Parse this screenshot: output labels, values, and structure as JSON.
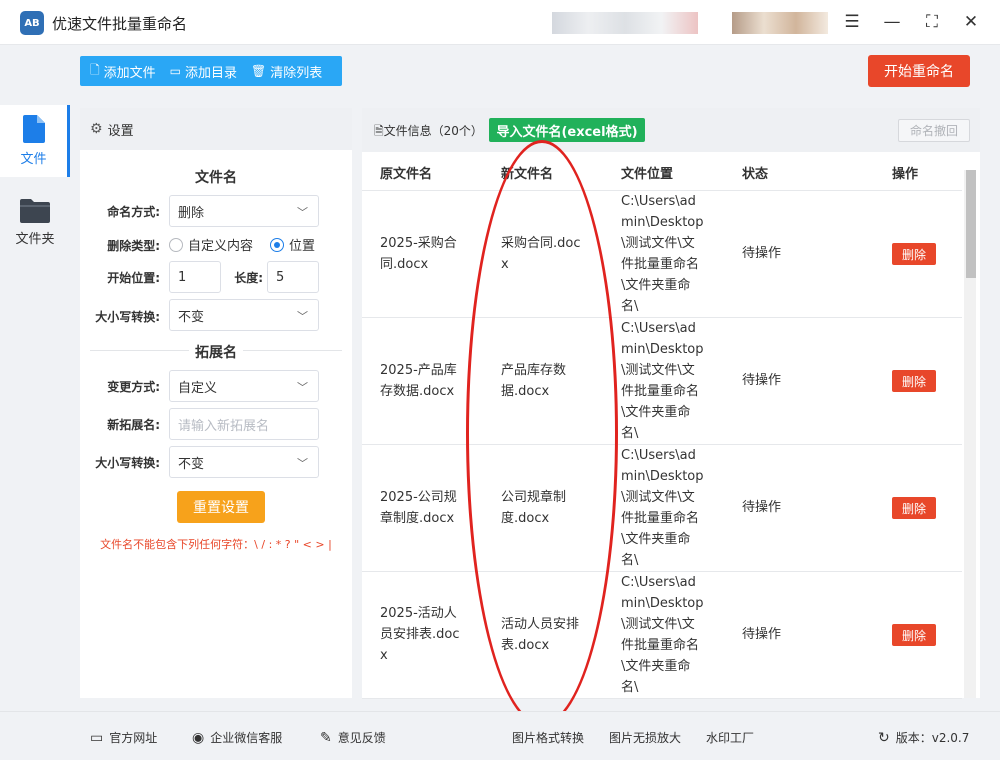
{
  "app": {
    "title": "优速文件批量重命名",
    "logo_text": "AB"
  },
  "window_buttons": {
    "menu": "☰",
    "minimize": "—",
    "maximize": "⛶",
    "close": "✕"
  },
  "nav": {
    "files_label": "文件",
    "folders_label": "文件夹"
  },
  "toolbar": {
    "add_file": "添加文件",
    "add_dir": "添加目录",
    "clear_list": "清除列表",
    "start": "开始重命名"
  },
  "settings": {
    "header": "设置",
    "filename_section": "文件名",
    "naming_label": "命名方式:",
    "naming_value": "删除",
    "delete_type_label": "删除类型:",
    "delete_type_option1": "自定义内容",
    "delete_type_option2": "位置",
    "start_pos_label": "开始位置:",
    "start_pos_value": "1",
    "length_label": "长度:",
    "length_value": "5",
    "case_label": "大小写转换:",
    "case_value": "不变",
    "ext_section": "拓展名",
    "change_mode_label": "变更方式:",
    "change_mode_value": "自定义",
    "new_ext_label": "新拓展名:",
    "new_ext_placeholder": "请输入新拓展名",
    "ext_case_label": "大小写转换:",
    "ext_case_value": "不变",
    "reset": "重置设置",
    "warning": "文件名不能包含下列任何字符：\\ / : * ? \" < > |"
  },
  "files": {
    "title": "文件信息（20个）",
    "import_button": "导入文件名(excel格式)",
    "undo_button": "命名撤回",
    "columns": [
      "原文件名",
      "新文件名",
      "文件位置",
      "状态",
      "操作"
    ],
    "rows": [
      {
        "orig": [
          "2025-采购合",
          "同.docx"
        ],
        "new": [
          "采购合同.doc",
          "x"
        ],
        "loc": [
          "C:\\Users\\ad",
          "min\\Desktop",
          "\\测试文件\\文",
          "件批量重命名",
          "\\文件夹重命",
          "名\\"
        ],
        "status": "待操作",
        "action": "删除"
      },
      {
        "orig": [
          "2025-产品库",
          "存数据.docx"
        ],
        "new": [
          "产品库存数",
          "据.docx"
        ],
        "loc": [
          "C:\\Users\\ad",
          "min\\Desktop",
          "\\测试文件\\文",
          "件批量重命名",
          "\\文件夹重命",
          "名\\"
        ],
        "status": "待操作",
        "action": "删除"
      },
      {
        "orig": [
          "2025-公司规",
          "章制度.docx"
        ],
        "new": [
          "公司规章制",
          "度.docx"
        ],
        "loc": [
          "C:\\Users\\ad",
          "min\\Desktop",
          "\\测试文件\\文",
          "件批量重命名",
          "\\文件夹重命",
          "名\\"
        ],
        "status": "待操作",
        "action": "删除"
      },
      {
        "orig": [
          "2025-活动人",
          "员安排表.doc",
          "x"
        ],
        "new": [
          "活动人员安排",
          "表.docx"
        ],
        "loc": [
          "C:\\Users\\ad",
          "min\\Desktop",
          "\\测试文件\\文",
          "件批量重命名",
          "\\文件夹重命",
          "名\\"
        ],
        "status": "待操作",
        "action": "删除"
      }
    ]
  },
  "footer": {
    "website": "官方网址",
    "wechat": "企业微信客服",
    "feedback": "意见反馈",
    "img_convert": "图片格式转换",
    "img_enlarge": "图片无损放大",
    "watermark": "水印工厂",
    "version": "版本：v2.0.7"
  },
  "colors": {
    "accent": "#1d7ee8",
    "toolbar": "#2aa7f5",
    "danger": "#e8472a",
    "import": "#21b15a",
    "reset": "#f7a21b",
    "highlight_ellipse": "#e0231f"
  }
}
